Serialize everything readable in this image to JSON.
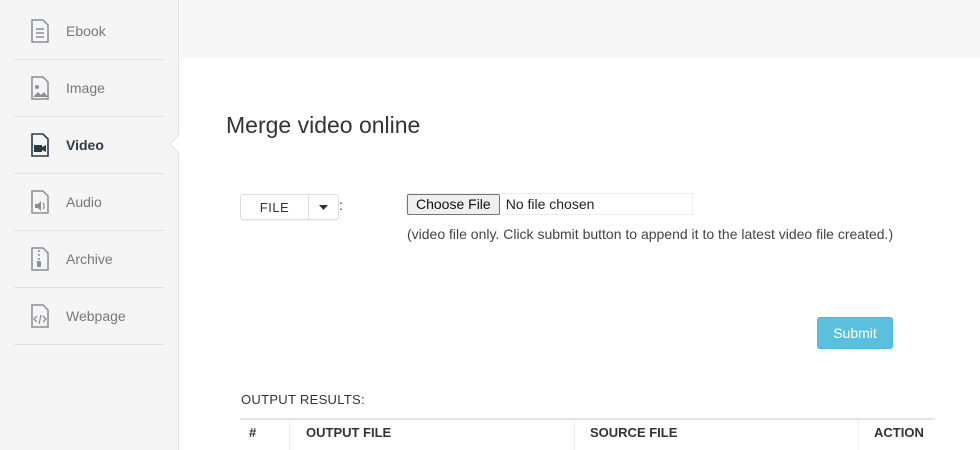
{
  "sidebar": {
    "items": [
      {
        "label": "Ebook",
        "icon": "ebook-icon",
        "active": false
      },
      {
        "label": "Image",
        "icon": "image-icon",
        "active": false
      },
      {
        "label": "Video",
        "icon": "video-icon",
        "active": true
      },
      {
        "label": "Audio",
        "icon": "audio-icon",
        "active": false
      },
      {
        "label": "Archive",
        "icon": "archive-icon",
        "active": false
      },
      {
        "label": "Webpage",
        "icon": "webpage-icon",
        "active": false
      }
    ]
  },
  "main": {
    "title": "Merge video online",
    "source_selector": {
      "label": "FILE",
      "separator": ":"
    },
    "file_input": {
      "button_label": "Choose File",
      "status": "No file chosen"
    },
    "hint": "(video file only. Click submit button to append it to the latest video file created.)",
    "submit_label": "Submit",
    "output": {
      "label": "OUTPUT RESULTS:",
      "columns": [
        "#",
        "OUTPUT FILE",
        "SOURCE FILE",
        "ACTION"
      ]
    }
  },
  "colors": {
    "accent": "#5bc0de",
    "sidebar_bg": "#f5f5f5",
    "active_text": "#2b3a4a"
  }
}
